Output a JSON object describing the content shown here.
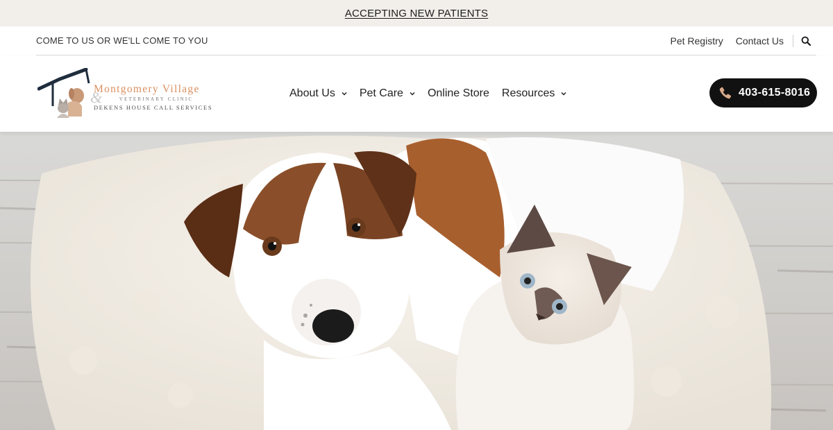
{
  "announcement": {
    "text": "ACCEPTING NEW PATIENTS"
  },
  "utility": {
    "tagline": "COME TO US OR WE'LL COME TO YOU",
    "links": [
      {
        "label": "Pet Registry"
      },
      {
        "label": "Contact Us"
      }
    ],
    "search_icon": "search-icon"
  },
  "logo": {
    "name": "Montgomery Village",
    "subtitle": "VETERINARY CLINIC",
    "ampersand": "&",
    "secondary": "DEKENS HOUSE CALL SERVICES"
  },
  "nav": {
    "items": [
      {
        "label": "About Us",
        "has_dropdown": true
      },
      {
        "label": "Pet Care",
        "has_dropdown": true
      },
      {
        "label": "Online Store",
        "has_dropdown": false
      },
      {
        "label": "Resources",
        "has_dropdown": true
      }
    ]
  },
  "phone": {
    "number": "403-615-8016",
    "icon": "phone-icon"
  },
  "hero": {
    "image": "dog-and-kitten-on-sheepskin-bed"
  },
  "colors": {
    "announce_bg": "#f2eee9",
    "brand_orange": "#d98f5f",
    "logo_navy": "#1f2d3d",
    "phone_bg": "#111111"
  }
}
